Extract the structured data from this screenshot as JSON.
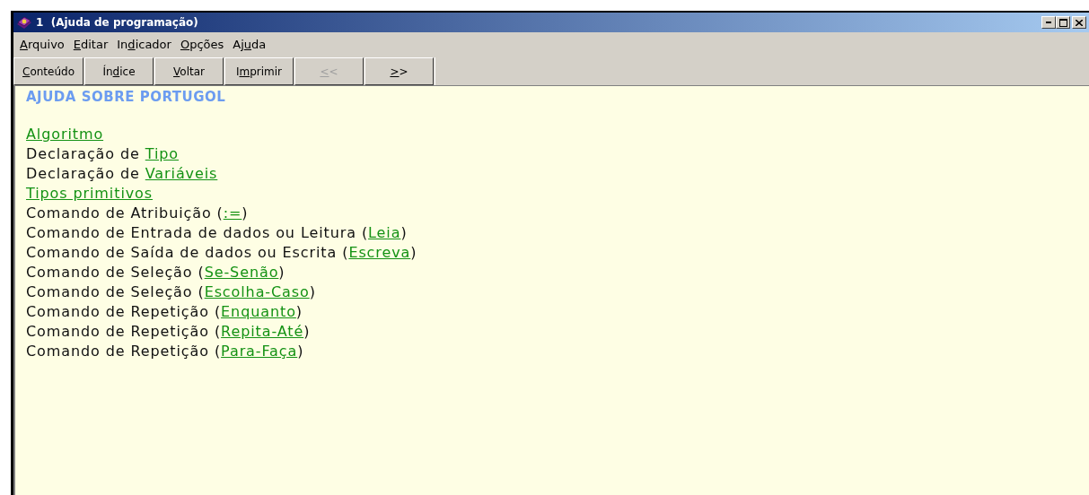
{
  "window": {
    "title": "1  (Ajuda de programação)"
  },
  "menu": [
    {
      "key": "A",
      "post": "rquivo"
    },
    {
      "key": "E",
      "post": "ditar"
    },
    {
      "pre": "In",
      "key": "d",
      "post": "icador"
    },
    {
      "key": "O",
      "post": "pções"
    },
    {
      "pre": "Aj",
      "key": "u",
      "post": "da"
    }
  ],
  "toolbar": [
    {
      "key": "C",
      "post": "onteúdo",
      "disabled": false
    },
    {
      "pre": "Ín",
      "key": "d",
      "post": "ice",
      "disabled": false
    },
    {
      "key": "V",
      "post": "oltar",
      "disabled": false
    },
    {
      "pre": "I",
      "key": "m",
      "post": "primir",
      "disabled": false
    },
    {
      "key": "<",
      "post": "<",
      "disabled": true
    },
    {
      "key": ">",
      "post": ">",
      "disabled": false
    }
  ],
  "content": {
    "heading": "AJUDA SOBRE PORTUGOL",
    "lines": [
      {
        "link": "Algoritmo"
      },
      {
        "text": "Declaração de ",
        "link": "Tipo"
      },
      {
        "text": "Declaração de ",
        "link": "Variáveis"
      },
      {
        "link": "Tipos primitivos"
      },
      {
        "text": "Comando de Atribuição (",
        "link": ":=",
        "after": ")"
      },
      {
        "text": "Comando de Entrada de dados ou Leitura (",
        "link": "Leia",
        "after": ")"
      },
      {
        "text": "Comando de Saída de dados ou Escrita (",
        "link": "Escreva",
        "after": ")"
      },
      {
        "text": "Comando de Seleção (",
        "link": "Se-Senão",
        "after": ")"
      },
      {
        "text": "Comando de Seleção (",
        "link": "Escolha-Caso",
        "after": ")"
      },
      {
        "text": "Comando de Repetição (",
        "link": "Enquanto",
        "after": ")"
      },
      {
        "text": "Comando de Repetição (",
        "link": "Repita-Até",
        "after": ")"
      },
      {
        "text": "Comando de Repetição (",
        "link": "Para-Faça",
        "after": ")"
      }
    ]
  }
}
